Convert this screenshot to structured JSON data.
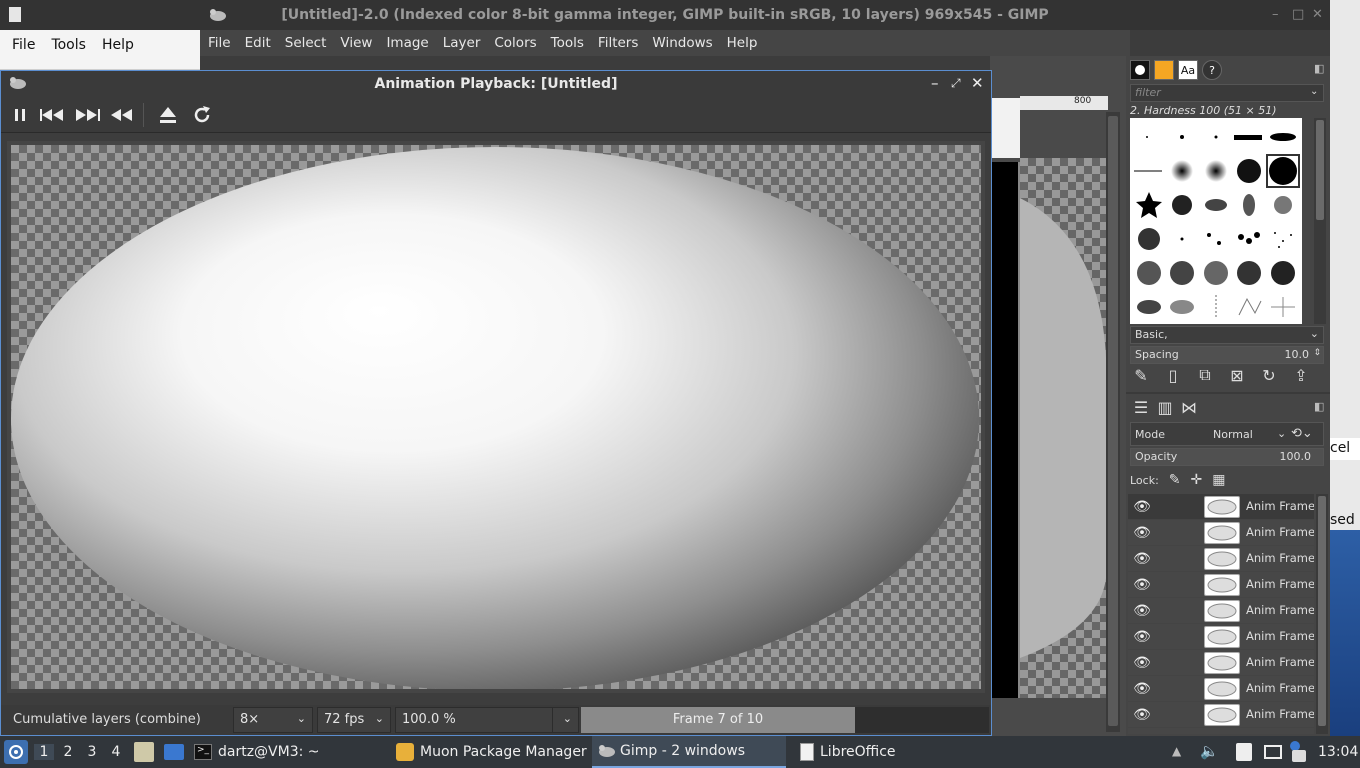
{
  "gimp_window": {
    "title": "[Untitled]-2.0 (Indexed color 8-bit gamma integer, GIMP built-in sRGB, 10 layers) 969x545 - GIMP",
    "menu": [
      "File",
      "Edit",
      "Select",
      "View",
      "Image",
      "Layer",
      "Colors",
      "Tools",
      "Filters",
      "Windows",
      "Help"
    ],
    "ruler_label": "800"
  },
  "left_window": {
    "menu": [
      "File",
      "Tools",
      "Help"
    ]
  },
  "right_partial": {
    "text1": "cel",
    "text2": "sed"
  },
  "anim_window": {
    "title": "Animation Playback: [Untitled]",
    "status_text": "Cumulative layers (combine)",
    "speed": "8×",
    "fps": "72 fps",
    "zoom": "100.0 %",
    "frame_label": "Frame 7 of 10",
    "frame_progress": 0.7
  },
  "dock": {
    "filter_placeholder": "filter",
    "brush_name": "2. Hardness 100 (51 × 51)",
    "brush_set": "Basic,",
    "spacing_label": "Spacing",
    "spacing_value": "10.0",
    "mode_label": "Mode",
    "mode_value": "Normal",
    "opacity_label": "Opacity",
    "opacity_value": "100.0",
    "lock_label": "Lock:",
    "layers": [
      {
        "name": "Anim Frame"
      },
      {
        "name": "Anim Frame"
      },
      {
        "name": "Anim Frame"
      },
      {
        "name": "Anim Frame"
      },
      {
        "name": "Anim Frame"
      },
      {
        "name": "Anim Frame"
      },
      {
        "name": "Anim Frame"
      },
      {
        "name": "Anim Frame"
      },
      {
        "name": "Anim Frame"
      }
    ]
  },
  "taskbar": {
    "desktops": [
      "1",
      "2",
      "3",
      "4"
    ],
    "tasks": [
      {
        "label": "dartz@VM3: ~"
      },
      {
        "label": "Muon Package Manager"
      },
      {
        "label": "Gimp - 2 windows"
      },
      {
        "label": "LibreOffice"
      }
    ],
    "clock": "13:04"
  }
}
